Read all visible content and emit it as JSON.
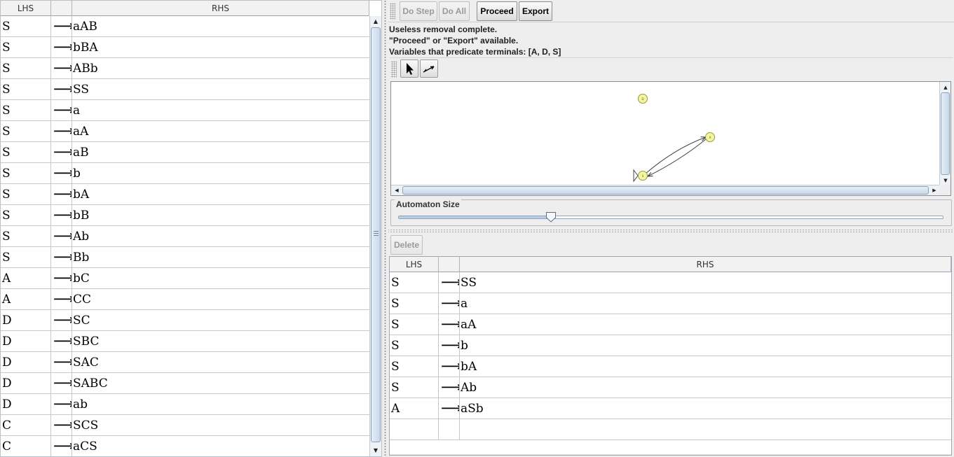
{
  "left_table": {
    "headers": {
      "lhs": "LHS",
      "arrow": "",
      "rhs": "RHS"
    },
    "arrow_glyph": "⟶",
    "rows": [
      {
        "lhs": "S",
        "rhs": "aAB"
      },
      {
        "lhs": "S",
        "rhs": "bBA"
      },
      {
        "lhs": "S",
        "rhs": "ABb"
      },
      {
        "lhs": "S",
        "rhs": "SS"
      },
      {
        "lhs": "S",
        "rhs": "a"
      },
      {
        "lhs": "S",
        "rhs": "aA"
      },
      {
        "lhs": "S",
        "rhs": "aB"
      },
      {
        "lhs": "S",
        "rhs": "b"
      },
      {
        "lhs": "S",
        "rhs": "bA"
      },
      {
        "lhs": "S",
        "rhs": "bB"
      },
      {
        "lhs": "S",
        "rhs": "Ab"
      },
      {
        "lhs": "S",
        "rhs": "Bb"
      },
      {
        "lhs": "A",
        "rhs": "bC"
      },
      {
        "lhs": "A",
        "rhs": "CC"
      },
      {
        "lhs": "D",
        "rhs": "SC"
      },
      {
        "lhs": "D",
        "rhs": "SBC"
      },
      {
        "lhs": "D",
        "rhs": "SAC"
      },
      {
        "lhs": "D",
        "rhs": "SABC"
      },
      {
        "lhs": "D",
        "rhs": "ab"
      },
      {
        "lhs": "C",
        "rhs": "SCS"
      },
      {
        "lhs": "C",
        "rhs": "aCS"
      }
    ]
  },
  "toolbar": {
    "do_step": "Do Step",
    "do_all": "Do All",
    "proceed": "Proceed",
    "export": "Export"
  },
  "status": {
    "line1": "Useless removal complete.",
    "line2": "\"Proceed\" or \"Export\" available.",
    "line3": "Variables that predicate terminals: [A, D, S]"
  },
  "tools": {
    "select_icon": "arrow-pointer-icon",
    "transition_icon": "transition-arrow-icon"
  },
  "automaton": {
    "states": [
      {
        "name": "D"
      },
      {
        "name": "A"
      },
      {
        "name": "S",
        "initial": true
      }
    ],
    "state_color": "#f5f5a0"
  },
  "size_panel": {
    "label": "Automaton Size",
    "value_fraction": 0.28
  },
  "delete_button": "Delete",
  "right_table": {
    "headers": {
      "lhs": "LHS",
      "arrow": "",
      "rhs": "RHS"
    },
    "rows": [
      {
        "lhs": "S",
        "rhs": "SS"
      },
      {
        "lhs": "S",
        "rhs": "a"
      },
      {
        "lhs": "S",
        "rhs": "aA"
      },
      {
        "lhs": "S",
        "rhs": "b"
      },
      {
        "lhs": "S",
        "rhs": "bA"
      },
      {
        "lhs": "S",
        "rhs": "Ab"
      },
      {
        "lhs": "A",
        "rhs": "aSb"
      },
      {
        "lhs": "",
        "rhs": ""
      }
    ]
  }
}
